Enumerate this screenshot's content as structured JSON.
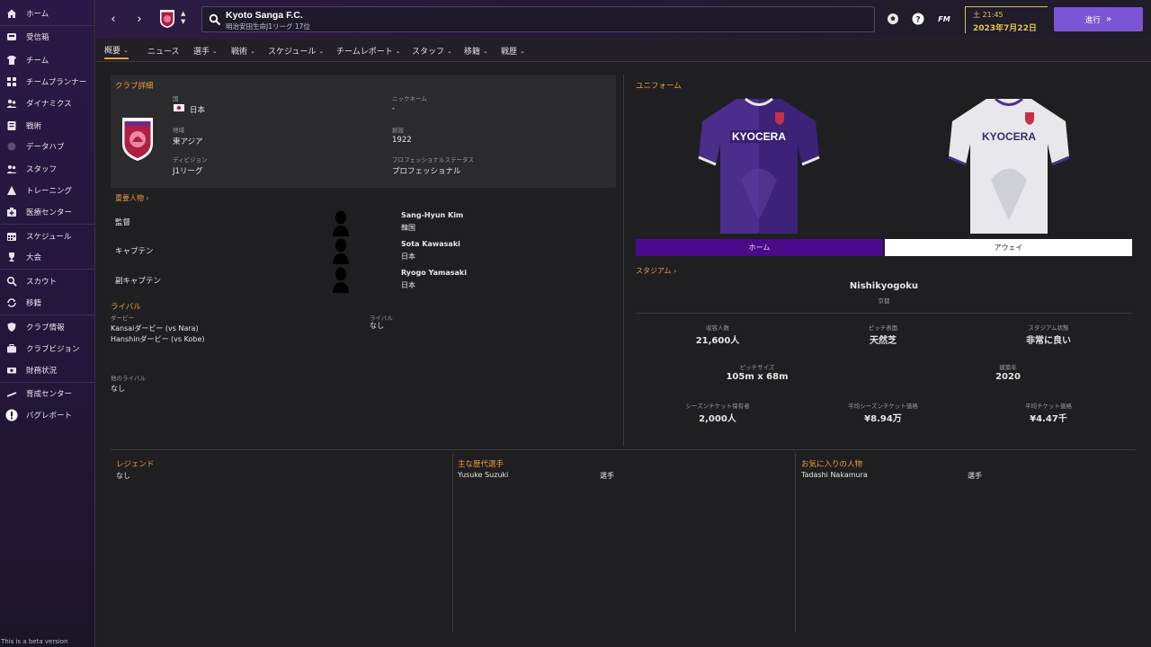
{
  "sidebar": {
    "items": [
      {
        "label": "ホーム",
        "icon": "home-icon"
      },
      {
        "label": "受信箱",
        "icon": "inbox-icon"
      },
      {
        "label": "チーム",
        "icon": "shirt-icon"
      },
      {
        "label": "チームプランナー",
        "icon": "planner-icon"
      },
      {
        "label": "ダイナミクス",
        "icon": "dynamics-icon"
      },
      {
        "label": "戦術",
        "icon": "tactics-icon"
      },
      {
        "label": "データハブ",
        "icon": "data-hub-icon"
      },
      {
        "label": "スタッフ",
        "icon": "staff-icon"
      },
      {
        "label": "トレーニング",
        "icon": "training-icon"
      },
      {
        "label": "医療センター",
        "icon": "medical-icon"
      },
      {
        "label": "スケジュール",
        "icon": "calendar-icon"
      },
      {
        "label": "大会",
        "icon": "trophy-icon"
      },
      {
        "label": "スカウト",
        "icon": "scout-icon"
      },
      {
        "label": "移籍",
        "icon": "transfer-icon"
      },
      {
        "label": "クラブ情報",
        "icon": "shield-icon"
      },
      {
        "label": "クラブビジョン",
        "icon": "briefcase-icon"
      },
      {
        "label": "財務状況",
        "icon": "finance-icon"
      },
      {
        "label": "育成センター",
        "icon": "development-icon"
      },
      {
        "label": "バグレポート",
        "icon": "bug-report-icon"
      }
    ],
    "beta_note": "This is a beta version"
  },
  "header": {
    "club_name": "Kyoto Sanga F.C.",
    "club_subtitle": "明治安田生命J1リーグ 17位",
    "fm_label": "FM",
    "time": "土 21:45",
    "date": "2023年7月22日",
    "continue_label": "進行"
  },
  "tabs": [
    {
      "label": "概要",
      "dropdown": true
    },
    {
      "label": "ニュース",
      "dropdown": false
    },
    {
      "label": "選手",
      "dropdown": true
    },
    {
      "label": "戦術",
      "dropdown": true
    },
    {
      "label": "スケジュール",
      "dropdown": true
    },
    {
      "label": "チームレポート",
      "dropdown": true
    },
    {
      "label": "スタッフ",
      "dropdown": true
    },
    {
      "label": "移籍",
      "dropdown": true
    },
    {
      "label": "戦歴",
      "dropdown": true
    }
  ],
  "club_details": {
    "title": "クラブ詳細",
    "nation_label": "国",
    "nation": "日本",
    "nickname_label": "ニックネーム",
    "nickname": "-",
    "region_label": "地域",
    "region": "東アジア",
    "founded_label": "創設",
    "founded": "1922",
    "division_label": "ディビジョン",
    "division": "J1リーグ",
    "status_label": "プロフェッショナルステータス",
    "status": "プロフェッショナル"
  },
  "key_people": {
    "title": "重要人物",
    "rows": [
      {
        "role": "監督",
        "name": "Sang-Hyun Kim",
        "nation": "韓国"
      },
      {
        "role": "キャプテン",
        "name": "Sota Kawasaki",
        "nation": "日本"
      },
      {
        "role": "副キャプテン",
        "name": "Ryogo Yamasaki",
        "nation": "日本"
      }
    ]
  },
  "rivals": {
    "title": "ライバル",
    "derby_label": "ダービー",
    "derbies": [
      "Kansaiダービー (vs Nara)",
      "Hanshinダービー (vs Kobe)"
    ],
    "rival_label": "ライバル",
    "rival_value": "なし",
    "other_label": "他のライバル",
    "other_value": "なし"
  },
  "kits": {
    "title": "ユニフォーム",
    "sponsor": "KYOCERA",
    "home_label": "ホーム",
    "away_label": "アウェイ",
    "colors": {
      "home_purple": "#4b2d8c",
      "away_white": "#e8e8ec",
      "home_bar": "#4a0a8a"
    }
  },
  "stadium": {
    "title": "スタジアム",
    "name": "Nishikyogoku",
    "city": "京都",
    "capacity_label": "収容人数",
    "capacity": "21,600人",
    "pitch_label": "ピッチ表面",
    "pitch": "天然芝",
    "condition_label": "スタジアム状態",
    "condition": "非常に良い",
    "size_label": "ピッチサイズ",
    "size": "105m x 68m",
    "built_label": "建築年",
    "built": "2020",
    "season_label": "シーズンチケット保有者",
    "season": "2,000人",
    "avg_season_label": "平均シーズンチケット価格",
    "avg_season": "¥8.94万",
    "avg_ticket_label": "平均チケット価格",
    "avg_ticket": "¥4.47千"
  },
  "legends": {
    "title": "レジェンド",
    "value": "なし"
  },
  "greats": {
    "title": "主な歴代選手",
    "name": "Yusuke Suzuki",
    "role": "選手"
  },
  "favourites": {
    "title": "お気に入りの人物",
    "name": "Tadashi Nakamura",
    "role": "選手"
  }
}
